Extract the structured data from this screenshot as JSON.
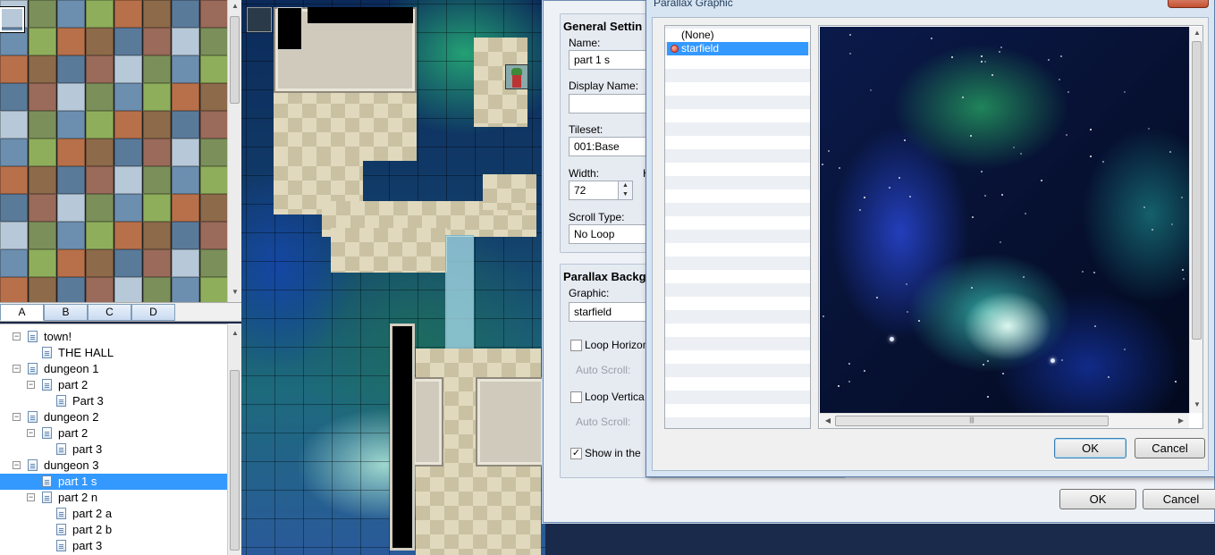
{
  "colors": {
    "selection": "#3399ff",
    "dialog_frame": "#d7e4f2",
    "close_button": "#c45132"
  },
  "tileset_tabs": [
    "A",
    "B",
    "C",
    "D"
  ],
  "map_tree": [
    {
      "label": "town!",
      "level": 0,
      "expander": "−"
    },
    {
      "label": "THE HALL",
      "level": 1,
      "expander": ""
    },
    {
      "label": "dungeon 1",
      "level": 0,
      "expander": "−"
    },
    {
      "label": "part 2",
      "level": 1,
      "expander": "−"
    },
    {
      "label": "Part 3",
      "level": 2,
      "expander": ""
    },
    {
      "label": "dungeon 2",
      "level": 0,
      "expander": "−"
    },
    {
      "label": "part 2",
      "level": 1,
      "expander": "−"
    },
    {
      "label": "part 3",
      "level": 2,
      "expander": ""
    },
    {
      "label": "dungeon 3",
      "level": 0,
      "expander": "−"
    },
    {
      "label": "part 1 s",
      "level": 1,
      "expander": "",
      "selected": true
    },
    {
      "label": "part 2 n",
      "level": 1,
      "expander": "−"
    },
    {
      "label": "part 2 a",
      "level": 2,
      "expander": ""
    },
    {
      "label": "part 2 b",
      "level": 2,
      "expander": ""
    },
    {
      "label": "part 3",
      "level": 2,
      "expander": ""
    }
  ],
  "map_properties": {
    "general_settings_legend": "General Settin",
    "name_label": "Name:",
    "name_value": "part 1 s",
    "display_name_label": "Display Name:",
    "display_name_value": "",
    "tileset_label": "Tileset:",
    "tileset_value": "001:Base",
    "width_label": "Width:",
    "width_value": "72",
    "height_label_cut": "H",
    "scroll_type_label": "Scroll Type:",
    "scroll_type_value": "No Loop",
    "parallax_legend": "Parallax Backg",
    "graphic_label": "Graphic:",
    "graphic_value": "starfield",
    "loop_horizontal_label": "Loop Horizon",
    "loop_horizontal_checked": false,
    "auto_scroll_label_1": "Auto Scroll:",
    "loop_vertical_label": "Loop Vertica",
    "loop_vertical_checked": false,
    "auto_scroll_label_2": "Auto Scroll:",
    "show_in_editor_label": "Show in the",
    "show_in_editor_checked": true,
    "ok_label": "OK",
    "cancel_label": "Cancel"
  },
  "parallax_dialog": {
    "title": "Parallax Graphic",
    "files": [
      {
        "label": "(None)",
        "selected": false
      },
      {
        "label": "starfield",
        "selected": true
      }
    ],
    "ok_label": "OK",
    "cancel_label": "Cancel"
  },
  "check_mark": "✓"
}
